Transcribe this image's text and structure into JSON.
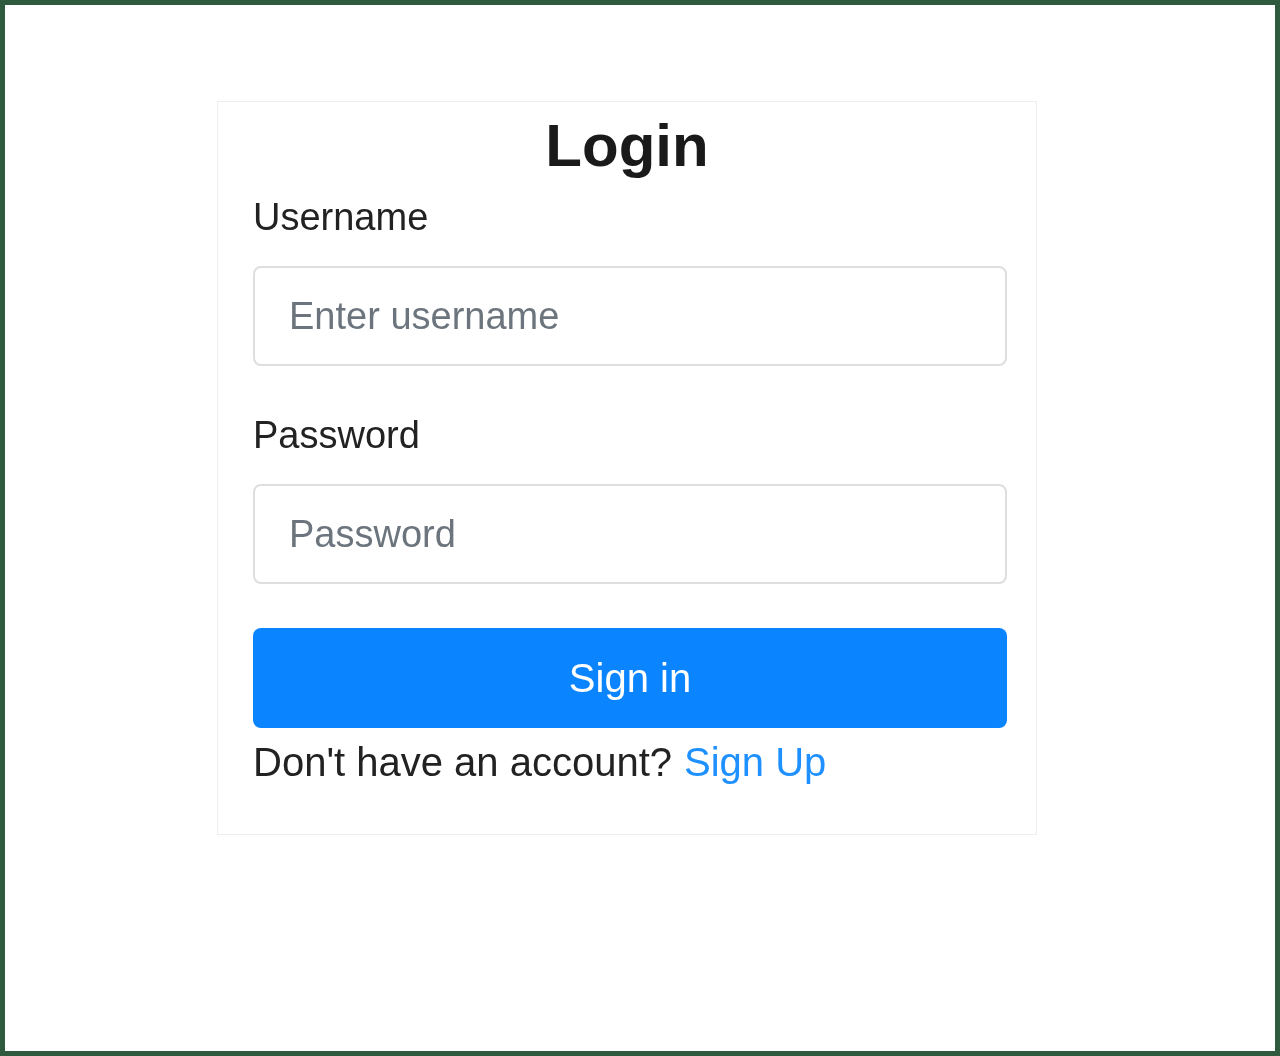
{
  "title": "Login",
  "fields": [
    {
      "label": "Username",
      "placeholder": "Enter username"
    },
    {
      "label": "Password",
      "placeholder": "Password"
    }
  ],
  "submit_button": "Sign in",
  "signup_prompt": {
    "text": "Don't have an account?",
    "link": "Sign Up"
  }
}
